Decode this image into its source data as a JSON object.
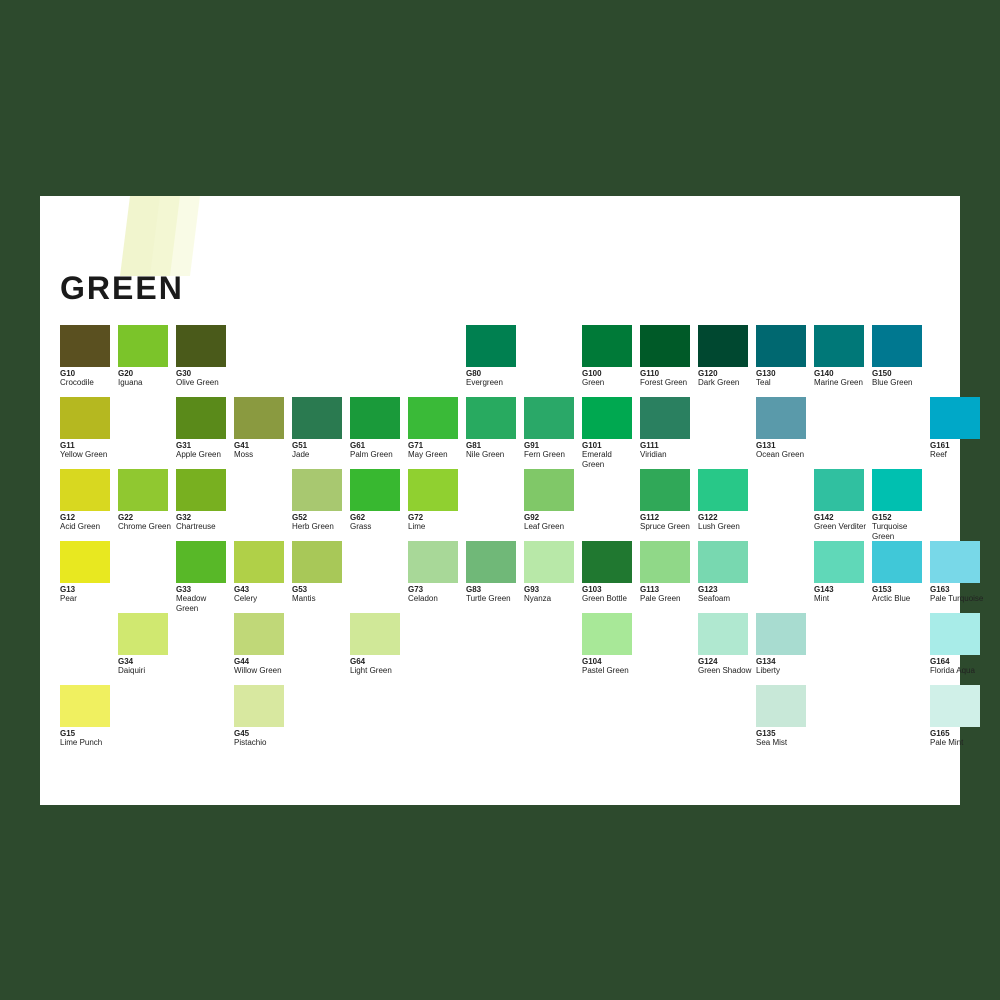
{
  "title": "GREEN",
  "colors": [
    {
      "code": "G10",
      "name": "Crocodile",
      "hex": "#5a5020",
      "col": 0,
      "row": 0
    },
    {
      "code": "G20",
      "name": "Iguana",
      "hex": "#7bc42a",
      "col": 1,
      "row": 0
    },
    {
      "code": "G30",
      "name": "Olive Green",
      "hex": "#4a5a1a",
      "col": 2,
      "row": 0
    },
    {
      "code": "G11",
      "name": "Yellow Green",
      "hex": "#b5b820",
      "col": 0,
      "row": 1
    },
    {
      "code": "G31",
      "name": "Apple Green",
      "hex": "#5a8a1a",
      "col": 2,
      "row": 1
    },
    {
      "code": "G41",
      "name": "Moss",
      "hex": "#8a9a40",
      "col": 3,
      "row": 1
    },
    {
      "code": "G51",
      "name": "Jade",
      "hex": "#2a7a50",
      "col": 4,
      "row": 1
    },
    {
      "code": "G61",
      "name": "Palm Green",
      "hex": "#1a9a3a",
      "col": 5,
      "row": 1
    },
    {
      "code": "G71",
      "name": "May Green",
      "hex": "#3aba38",
      "col": 6,
      "row": 1
    },
    {
      "code": "G81",
      "name": "Nile Green",
      "hex": "#28aa60",
      "col": 7,
      "row": 1
    },
    {
      "code": "G91",
      "name": "Fern Green",
      "hex": "#2aa868",
      "col": 8,
      "row": 1
    },
    {
      "code": "G101",
      "name": "Emerald Green",
      "hex": "#00a850",
      "col": 9,
      "row": 1
    },
    {
      "code": "G111",
      "name": "Viridian",
      "hex": "#2a8060",
      "col": 10,
      "row": 1
    },
    {
      "code": "G131",
      "name": "Ocean Green",
      "hex": "#5a9aaa",
      "col": 12,
      "row": 1
    },
    {
      "code": "G161",
      "name": "Reef",
      "hex": "#00a8c8",
      "col": 15,
      "row": 1
    },
    {
      "code": "G12",
      "name": "Acid Green",
      "hex": "#d8d820",
      "col": 0,
      "row": 2
    },
    {
      "code": "G22",
      "name": "Chrome Green",
      "hex": "#90c830",
      "col": 1,
      "row": 2
    },
    {
      "code": "G32",
      "name": "Chartreuse",
      "hex": "#78b020",
      "col": 2,
      "row": 2
    },
    {
      "code": "G52",
      "name": "Herb Green",
      "hex": "#a8c870",
      "col": 4,
      "row": 2
    },
    {
      "code": "G62",
      "name": "Grass",
      "hex": "#38b830",
      "col": 5,
      "row": 2
    },
    {
      "code": "G72",
      "name": "Lime",
      "hex": "#90d030",
      "col": 6,
      "row": 2
    },
    {
      "code": "G92",
      "name": "Leaf Green",
      "hex": "#80c868",
      "col": 8,
      "row": 2
    },
    {
      "code": "G112",
      "name": "Spruce Green",
      "hex": "#30a858",
      "col": 10,
      "row": 2
    },
    {
      "code": "G122",
      "name": "Lush Green",
      "hex": "#28c888",
      "col": 11,
      "row": 2
    },
    {
      "code": "G142",
      "name": "Green Verditer",
      "hex": "#30c0a0",
      "col": 13,
      "row": 2
    },
    {
      "code": "G152",
      "name": "Turquoise Green",
      "hex": "#00c0b0",
      "col": 14,
      "row": 2
    },
    {
      "code": "G13",
      "name": "Pear",
      "hex": "#e8e820",
      "col": 0,
      "row": 3
    },
    {
      "code": "G33",
      "name": "Meadow Green",
      "hex": "#58b828",
      "col": 2,
      "row": 3
    },
    {
      "code": "G43",
      "name": "Celery",
      "hex": "#b0d048",
      "col": 3,
      "row": 3
    },
    {
      "code": "G53",
      "name": "Mantis",
      "hex": "#a8c858",
      "col": 4,
      "row": 3
    },
    {
      "code": "G73",
      "name": "Celadon",
      "hex": "#a8d898",
      "col": 6,
      "row": 3
    },
    {
      "code": "G83",
      "name": "Turtle Green",
      "hex": "#70b878",
      "col": 7,
      "row": 3
    },
    {
      "code": "G93",
      "name": "Nyanza",
      "hex": "#b8e8a8",
      "col": 8,
      "row": 3
    },
    {
      "code": "G103",
      "name": "Green Bottle",
      "hex": "#207830",
      "col": 9,
      "row": 3
    },
    {
      "code": "G113",
      "name": "Pale Green",
      "hex": "#90d888",
      "col": 10,
      "row": 3
    },
    {
      "code": "G123",
      "name": "Seafoam",
      "hex": "#78d8b0",
      "col": 11,
      "row": 3
    },
    {
      "code": "G143",
      "name": "Mint",
      "hex": "#60d8b8",
      "col": 13,
      "row": 3
    },
    {
      "code": "G153",
      "name": "Arctic Blue",
      "hex": "#40c8d8",
      "col": 14,
      "row": 3
    },
    {
      "code": "G163",
      "name": "Pale Turquoise",
      "hex": "#78d8e8",
      "col": 15,
      "row": 3
    },
    {
      "code": "G34",
      "name": "Daiquiri",
      "hex": "#d0e870",
      "col": 1,
      "row": 4
    },
    {
      "code": "G44",
      "name": "Willow Green",
      "hex": "#c0d878",
      "col": 3,
      "row": 4
    },
    {
      "code": "G64",
      "name": "Light Green",
      "hex": "#d0e898",
      "col": 5,
      "row": 4
    },
    {
      "code": "G104",
      "name": "Pastel Green",
      "hex": "#a8e898",
      "col": 9,
      "row": 4
    },
    {
      "code": "G124",
      "name": "Green Shadow",
      "hex": "#b0e8d0",
      "col": 11,
      "row": 4
    },
    {
      "code": "G134",
      "name": "Liberty",
      "hex": "#a8dcd0",
      "col": 12,
      "row": 4
    },
    {
      "code": "G164",
      "name": "Florida Aqua",
      "hex": "#a8ece8",
      "col": 15,
      "row": 4
    },
    {
      "code": "G15",
      "name": "Lime Punch",
      "hex": "#f0f060",
      "col": 0,
      "row": 5
    },
    {
      "code": "G45",
      "name": "Pistachio",
      "hex": "#d8e8a0",
      "col": 3,
      "row": 5
    },
    {
      "code": "G135",
      "name": "Sea Mist",
      "hex": "#c8e8d8",
      "col": 12,
      "row": 5
    },
    {
      "code": "G165",
      "name": "Pale Mint",
      "hex": "#d0f0e8",
      "col": 15,
      "row": 5
    },
    {
      "code": "G80",
      "name": "Evergreen",
      "hex": "#008050",
      "col": 7,
      "row": 0
    },
    {
      "code": "G100",
      "name": "Green",
      "hex": "#007a38",
      "col": 9,
      "row": 0
    },
    {
      "code": "G110",
      "name": "Forest Green",
      "hex": "#005a28",
      "col": 10,
      "row": 0
    },
    {
      "code": "G120",
      "name": "Dark Green",
      "hex": "#004830",
      "col": 11,
      "row": 0
    },
    {
      "code": "G130",
      "name": "Teal",
      "hex": "#006870",
      "col": 12,
      "row": 0
    },
    {
      "code": "G140",
      "name": "Marine Green",
      "hex": "#007878",
      "col": 13,
      "row": 0
    },
    {
      "code": "G150",
      "name": "Blue Green",
      "hex": "#007890",
      "col": 14,
      "row": 0
    }
  ]
}
